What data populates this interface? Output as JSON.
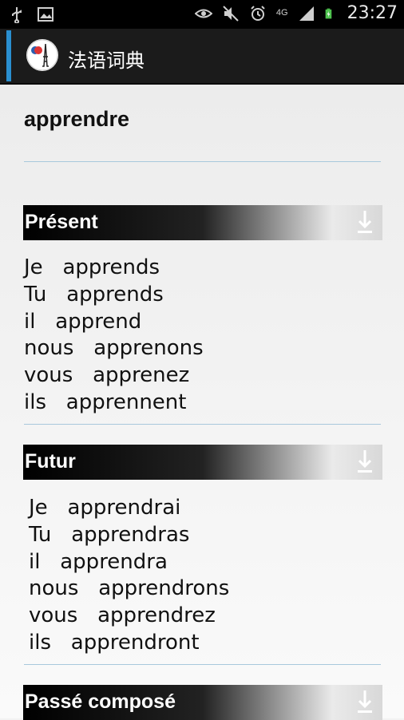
{
  "status_bar": {
    "time": "23:27",
    "icons": [
      "usb-icon",
      "image-icon",
      "eye-icon",
      "mute-icon",
      "alarm-icon",
      "4g-icon",
      "signal-icon",
      "battery-charging-icon"
    ],
    "network_label": "4G"
  },
  "action_bar": {
    "title": "法语词典",
    "logo": "eiffel-tower-logo-icon",
    "accent_color": "#2a8fd0"
  },
  "word": "apprendre",
  "sections": [
    {
      "title": "Présent",
      "forms": [
        {
          "pronoun": "Je",
          "verb": "apprends"
        },
        {
          "pronoun": "Tu",
          "verb": "apprends"
        },
        {
          "pronoun": "il",
          "verb": "apprend"
        },
        {
          "pronoun": "nous",
          "verb": "apprenons"
        },
        {
          "pronoun": "vous",
          "verb": "apprenez"
        },
        {
          "pronoun": "ils",
          "verb": "apprennent"
        }
      ]
    },
    {
      "title": "Futur",
      "forms": [
        {
          "pronoun": "Je",
          "verb": "apprendrai"
        },
        {
          "pronoun": "Tu",
          "verb": "apprendras"
        },
        {
          "pronoun": "il",
          "verb": "apprendra"
        },
        {
          "pronoun": "nous",
          "verb": "apprendrons"
        },
        {
          "pronoun": "vous",
          "verb": "apprendrez"
        },
        {
          "pronoun": "ils",
          "verb": "apprendront"
        }
      ]
    },
    {
      "title": "Passé composé",
      "forms": []
    }
  ]
}
